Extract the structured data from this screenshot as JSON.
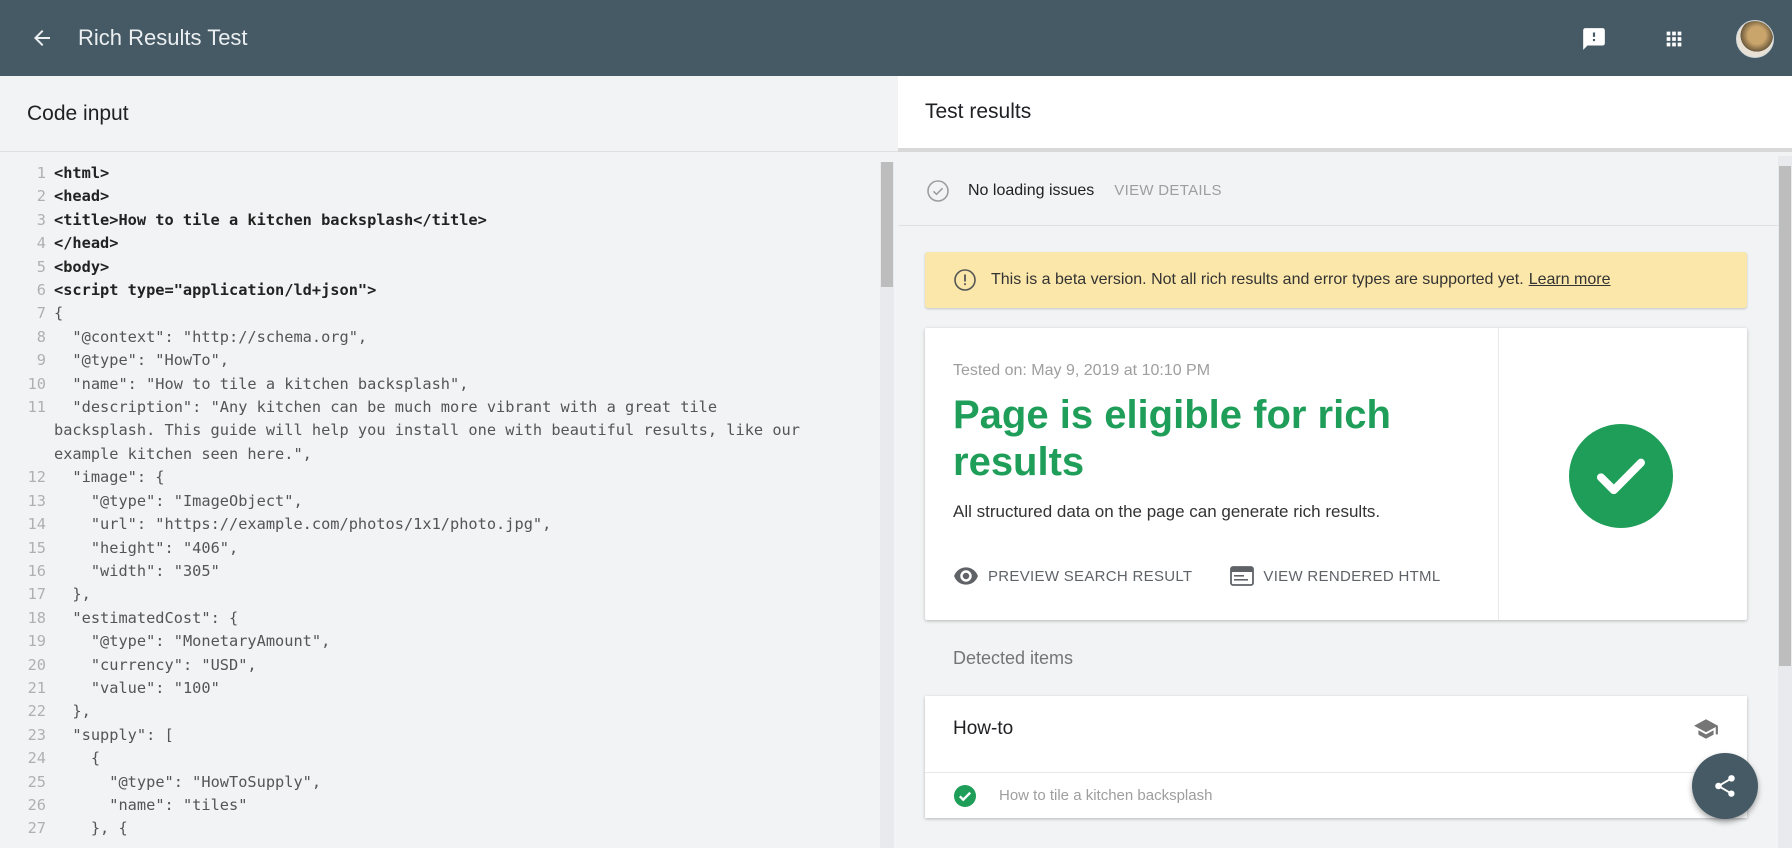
{
  "header": {
    "title": "Rich Results Test",
    "icons": [
      "arrow-back-icon",
      "feedback-icon",
      "apps-icon",
      "avatar"
    ]
  },
  "code_panel": {
    "title": "Code input",
    "lines": [
      {
        "n": "1",
        "t": "<html>"
      },
      {
        "n": "2",
        "t": "<head>"
      },
      {
        "n": "3",
        "t": "<title>How to tile a kitchen backsplash</title>"
      },
      {
        "n": "4",
        "t": "</head>"
      },
      {
        "n": "5",
        "t": "<body>"
      },
      {
        "n": "6",
        "t": "<script type=\"application/ld+json\">"
      },
      {
        "n": "7",
        "t": "{"
      },
      {
        "n": "8",
        "t": "  \"@context\": \"http://schema.org\","
      },
      {
        "n": "9",
        "t": "  \"@type\": \"HowTo\","
      },
      {
        "n": "10",
        "t": "  \"name\": \"How to tile a kitchen backsplash\","
      },
      {
        "n": "11",
        "t": "  \"description\": \"Any kitchen can be much more vibrant with a great tile\nbacksplash. This guide will help you install one with beautiful results, like our\nexample kitchen seen here.\","
      },
      {
        "n": "12",
        "t": "  \"image\": {"
      },
      {
        "n": "13",
        "t": "    \"@type\": \"ImageObject\","
      },
      {
        "n": "14",
        "t": "    \"url\": \"https://example.com/photos/1x1/photo.jpg\","
      },
      {
        "n": "15",
        "t": "    \"height\": \"406\","
      },
      {
        "n": "16",
        "t": "    \"width\": \"305\""
      },
      {
        "n": "17",
        "t": "  },"
      },
      {
        "n": "18",
        "t": "  \"estimatedCost\": {"
      },
      {
        "n": "19",
        "t": "    \"@type\": \"MonetaryAmount\","
      },
      {
        "n": "20",
        "t": "    \"currency\": \"USD\","
      },
      {
        "n": "21",
        "t": "    \"value\": \"100\""
      },
      {
        "n": "22",
        "t": "  },"
      },
      {
        "n": "23",
        "t": "  \"supply\": ["
      },
      {
        "n": "24",
        "t": "    {"
      },
      {
        "n": "25",
        "t": "      \"@type\": \"HowToSupply\","
      },
      {
        "n": "26",
        "t": "      \"name\": \"tiles\""
      },
      {
        "n": "27",
        "t": "    }, {"
      }
    ]
  },
  "results_panel": {
    "title": "Test results",
    "loading_status": "No loading issues",
    "view_details": "VIEW DETAILS",
    "beta_notice": "This is a beta version. Not all rich results and error types are supported yet.",
    "learn_more": "Learn more",
    "tested_on": "Tested on: May 9, 2019 at 10:10 PM",
    "headline": "Page is eligible for rich results",
    "subtext": "All structured data on the page can generate rich results.",
    "preview_label": "PREVIEW SEARCH RESULT",
    "rendered_label": "VIEW RENDERED HTML",
    "detected_label": "Detected items",
    "item_title": "How-to",
    "item_name": "How to tile a kitchen backsplash"
  },
  "colors": {
    "topbar": "#455a64",
    "success_green": "#1e9e58",
    "beta_bg": "#fbe7a9"
  }
}
